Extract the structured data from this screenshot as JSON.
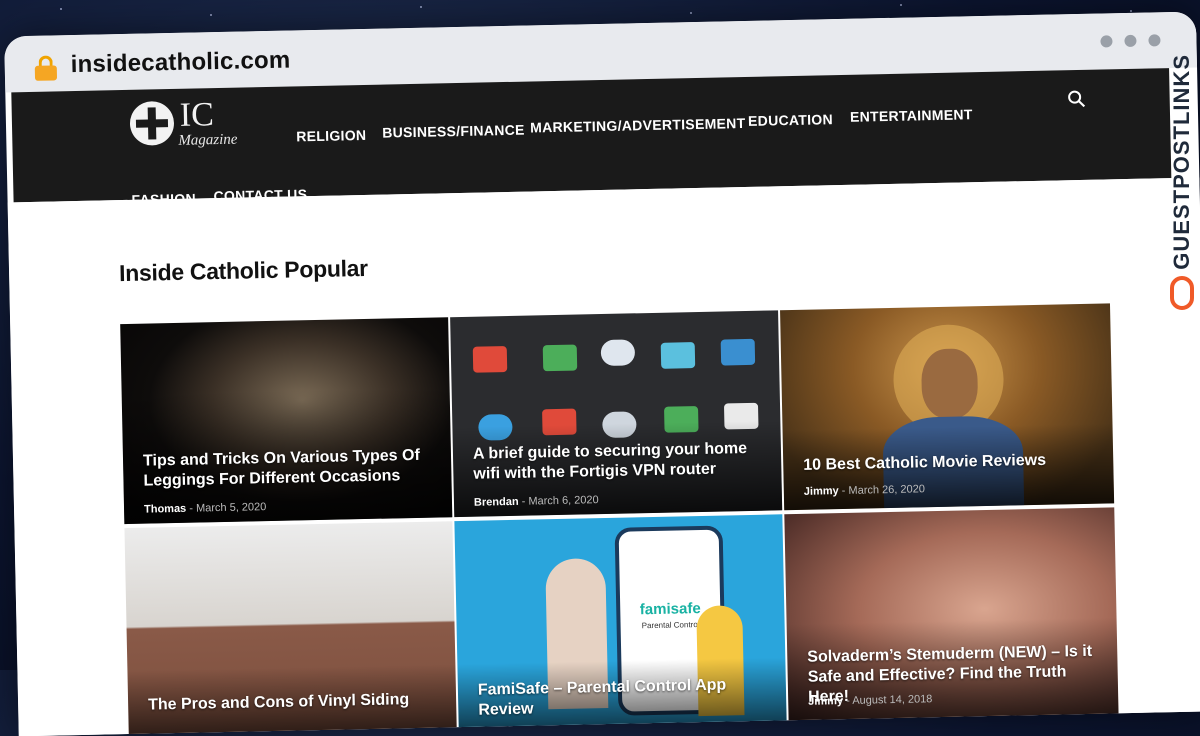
{
  "browser": {
    "url": "insidecatholic.com"
  },
  "logo": {
    "ic": "IC",
    "magazine": "Magazine"
  },
  "nav": {
    "items": [
      "RELIGION",
      "BUSINESS/FINANCE",
      "MARKETING/ADVERTISEMENT",
      "EDUCATION",
      "ENTERTAINMENT",
      "FASHION",
      "CONTACT US"
    ]
  },
  "section": {
    "title": "Inside Catholic Popular"
  },
  "articles": [
    {
      "title": "Tips and Tricks On Various Types Of Leggings For Different Occasions",
      "author": "Thomas",
      "date": "March 5, 2020"
    },
    {
      "title": "A brief guide to securing your home wifi with the Fortigis VPN router",
      "author": "Brendan",
      "date": "March 6, 2020"
    },
    {
      "title": "10 Best Catholic Movie Reviews",
      "author": "Jimmy",
      "date": "March 26, 2020"
    },
    {
      "title": "The Pros and Cons of Vinyl Siding",
      "author": "",
      "date": ""
    },
    {
      "title": "FamiSafe – Parental Control App Review",
      "author": "",
      "date": ""
    },
    {
      "title": "Solvaderm’s Stemuderm (NEW) – Is it Safe and Effective? Find the Truth Here!",
      "author": "Jimmy",
      "date": "August 14, 2018"
    }
  ],
  "famisafe": {
    "brand": "famisafe",
    "sub": "Parental Control"
  },
  "badge": {
    "text": "GUESTPOSTLINKS"
  },
  "colors": {
    "navbar": "#1a1a1a",
    "accent": "#f05a28"
  }
}
